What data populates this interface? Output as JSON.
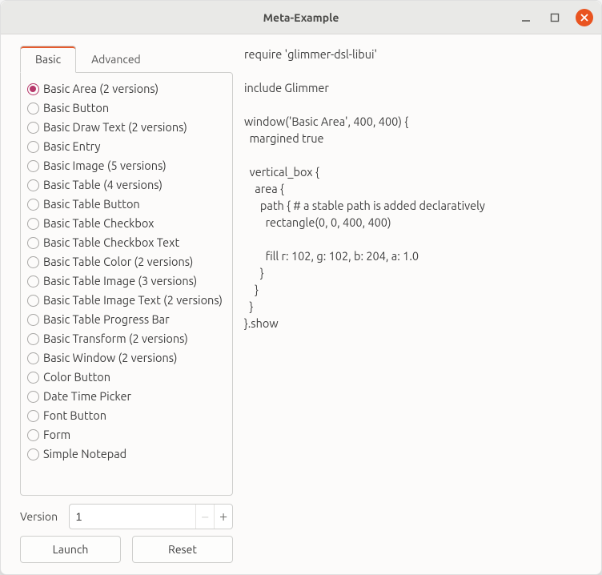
{
  "window": {
    "title": "Meta-Example"
  },
  "tabs": {
    "basic": "Basic",
    "advanced": "Advanced",
    "active_index": 0
  },
  "examples": [
    {
      "label": "Basic Area (2 versions)",
      "selected": true
    },
    {
      "label": "Basic Button",
      "selected": false
    },
    {
      "label": "Basic Draw Text (2 versions)",
      "selected": false
    },
    {
      "label": "Basic Entry",
      "selected": false
    },
    {
      "label": "Basic Image (5 versions)",
      "selected": false
    },
    {
      "label": "Basic Table (4 versions)",
      "selected": false
    },
    {
      "label": "Basic Table Button",
      "selected": false
    },
    {
      "label": "Basic Table Checkbox",
      "selected": false
    },
    {
      "label": "Basic Table Checkbox Text",
      "selected": false
    },
    {
      "label": "Basic Table Color (2 versions)",
      "selected": false
    },
    {
      "label": "Basic Table Image (3 versions)",
      "selected": false
    },
    {
      "label": "Basic Table Image Text (2 versions)",
      "selected": false
    },
    {
      "label": "Basic Table Progress Bar",
      "selected": false
    },
    {
      "label": "Basic Transform (2 versions)",
      "selected": false
    },
    {
      "label": "Basic Window (2 versions)",
      "selected": false
    },
    {
      "label": "Color Button",
      "selected": false
    },
    {
      "label": "Date Time Picker",
      "selected": false
    },
    {
      "label": "Font Button",
      "selected": false
    },
    {
      "label": "Form",
      "selected": false
    },
    {
      "label": "Simple Notepad",
      "selected": false
    }
  ],
  "version": {
    "label": "Version",
    "value": "1"
  },
  "buttons": {
    "launch": "Launch",
    "reset": "Reset"
  },
  "code": "require 'glimmer-dsl-libui'\n\ninclude Glimmer\n\nwindow('Basic Area', 400, 400) {\n  margined true\n\n  vertical_box {\n    area {\n      path { # a stable path is added declaratively\n        rectangle(0, 0, 400, 400)\n\n        fill r: 102, g: 102, b: 204, a: 1.0\n      }\n    }\n  }\n}.show",
  "colors": {
    "accent": "#e95420",
    "radio_selected": "#b6386b"
  }
}
